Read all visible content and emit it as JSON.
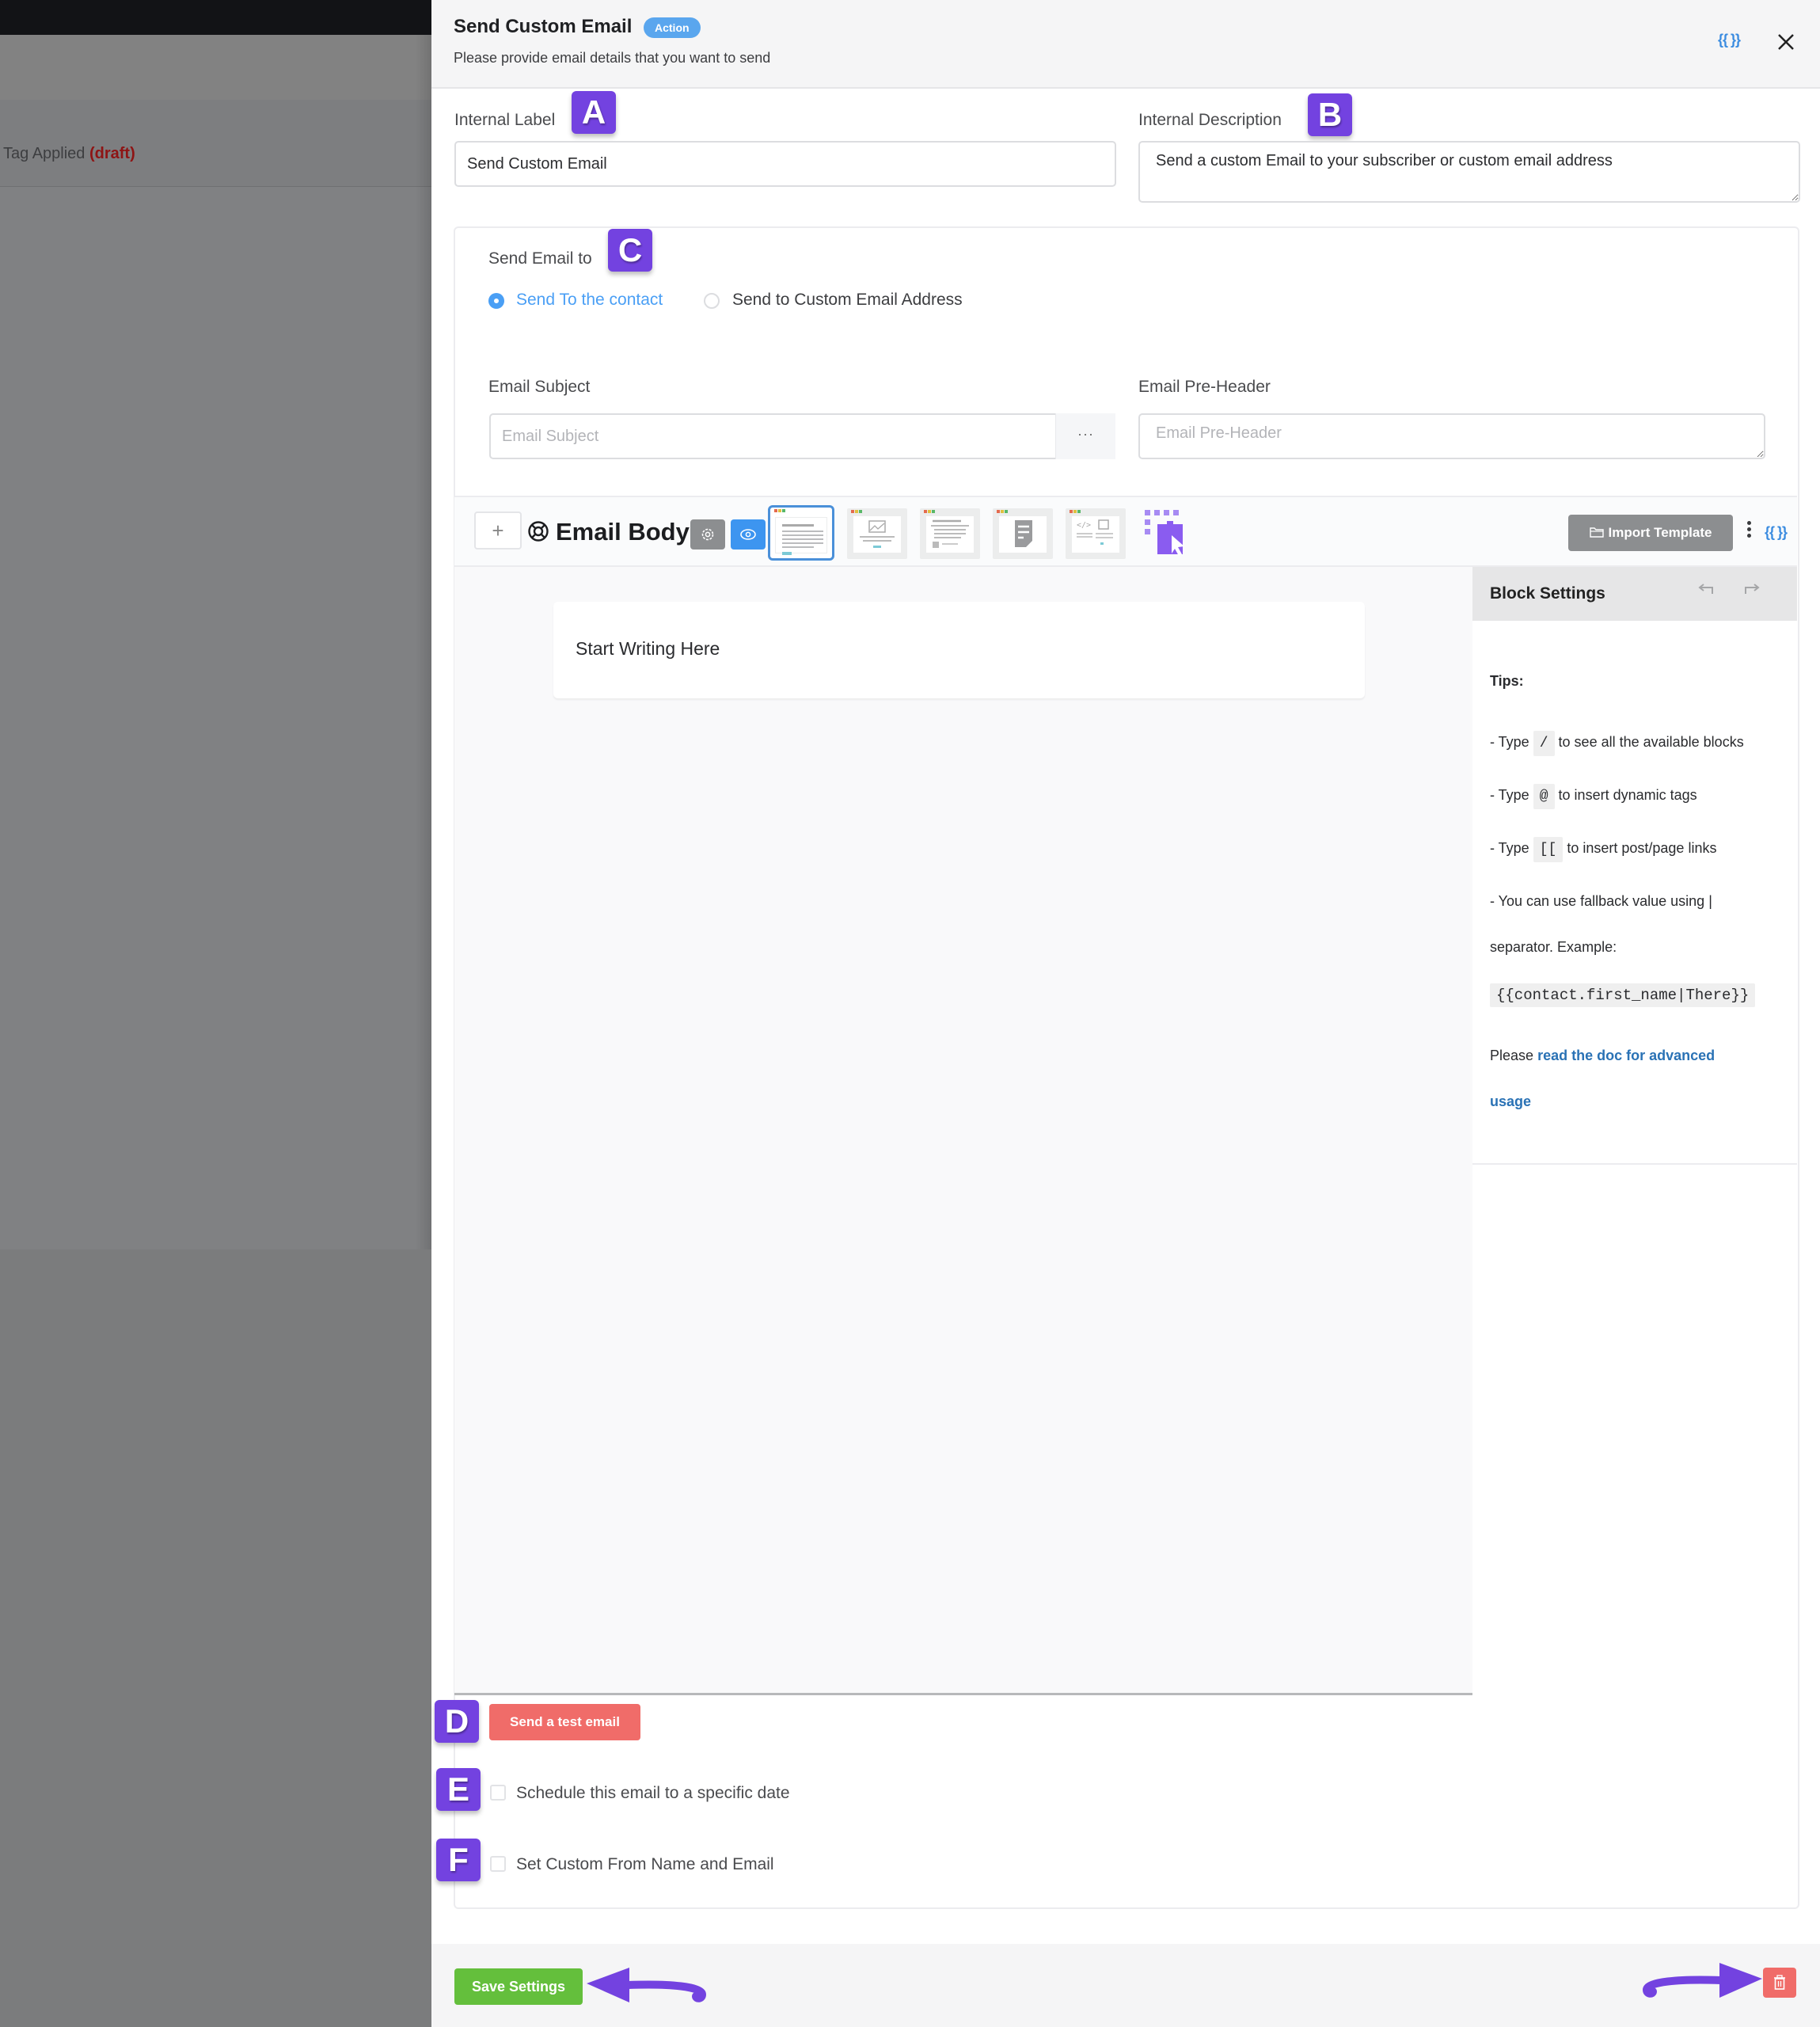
{
  "background": {
    "breadcrumb_text": "Tag Applied",
    "breadcrumb_status": "(draft)"
  },
  "header": {
    "title": "Send Custom Email",
    "badge": "Action",
    "subtitle": "Please provide email details that you want to send",
    "tags_icon": "{{ }}",
    "close_icon": "close-icon"
  },
  "markers": [
    "A",
    "B",
    "C",
    "D",
    "E",
    "F"
  ],
  "internal_label": {
    "label": "Internal Label",
    "value": "Send Custom Email"
  },
  "internal_description": {
    "label": "Internal Description",
    "value": "Send a custom Email to your subscriber or custom email address"
  },
  "send_email_to": {
    "label": "Send Email to",
    "options": [
      {
        "label": "Send To the contact",
        "selected": true
      },
      {
        "label": "Send to Custom Email Address",
        "selected": false
      }
    ]
  },
  "email_subject": {
    "label": "Email Subject",
    "placeholder": "Email Subject",
    "value": "",
    "more_icon": "···"
  },
  "email_preheader": {
    "label": "Email Pre-Header",
    "placeholder": "Email Pre-Header",
    "value": ""
  },
  "editor": {
    "add_icon": "+",
    "title": "Email Body",
    "buttons": [
      "settings-gear-icon",
      "preview-eye-icon"
    ],
    "templates": [
      {
        "name": "simple-text-template",
        "selected": true
      },
      {
        "name": "image-text-template",
        "selected": false
      },
      {
        "name": "list-template",
        "selected": false
      },
      {
        "name": "plain-note-template",
        "selected": false
      },
      {
        "name": "html-code-template",
        "selected": false
      },
      {
        "name": "visual-builder-template",
        "selected": false
      }
    ],
    "import_template_label": "Import Template",
    "tags_icon": "{{ }}",
    "placeholder_text": "Start Writing Here"
  },
  "block_settings": {
    "title": "Block Settings",
    "tips_heading": "Tips:",
    "tips": [
      {
        "prefix": "- Type",
        "code": "/",
        "suffix": "to see all the available blocks"
      },
      {
        "prefix": "- Type",
        "code": "@",
        "suffix": "to insert dynamic tags"
      },
      {
        "prefix": "- Type",
        "code": "[[",
        "suffix": "to insert post/page links"
      }
    ],
    "fallback_line1": "- You can use fallback value using |",
    "fallback_line2": "separator. Example:",
    "example_code": "{{contact.first_name|There}}",
    "doc_prefix": "Please",
    "doc_link_line1": "read the doc for advanced",
    "doc_link_line2": "usage"
  },
  "test_email_button": "Send a test email",
  "schedule_checkbox": {
    "label": "Schedule this email to a specific date",
    "checked": false
  },
  "custom_from_checkbox": {
    "label": "Set Custom From Name and Email",
    "checked": false
  },
  "footer": {
    "save_label": "Save Settings",
    "delete_icon": "trash-icon"
  },
  "colors": {
    "accent_blue": "#4a9ff5",
    "badge_blue": "#5aa6ee",
    "save_green": "#64bf3c",
    "danger_red": "#f06c69",
    "marker_purple": "#7342e0"
  }
}
